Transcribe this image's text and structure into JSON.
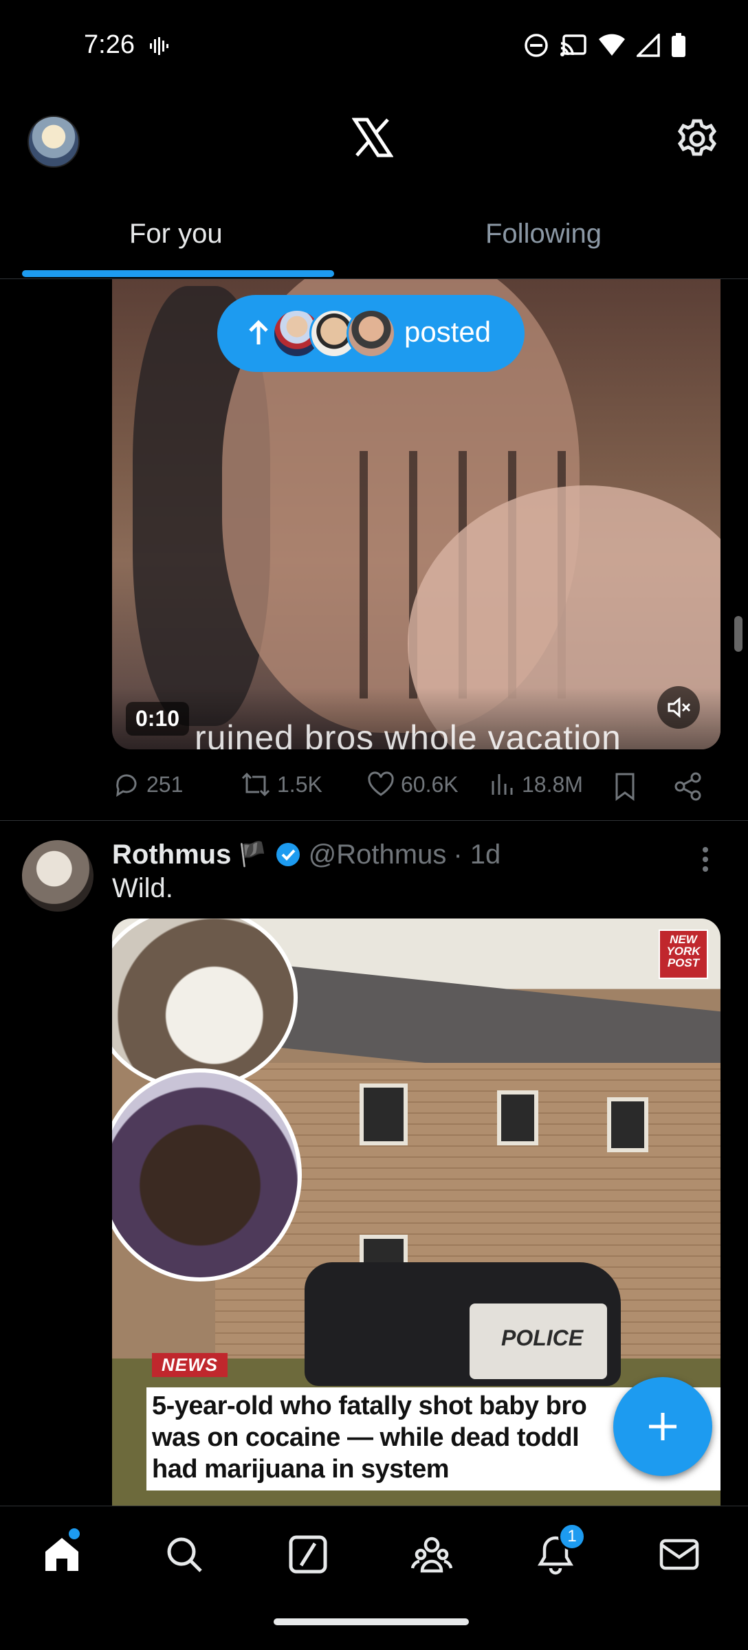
{
  "status_bar": {
    "time": "7:26"
  },
  "header": {
    "tabs": [
      {
        "label": "For you"
      },
      {
        "label": "Following"
      }
    ]
  },
  "video_post": {
    "posted_pill_label": "posted",
    "duration": "0:10",
    "caption": "ruined bros whole vacation",
    "stats": {
      "replies": "251",
      "reposts": "1.5K",
      "likes": "60.6K",
      "views": "18.8M"
    }
  },
  "tweet": {
    "name": "Rothmus",
    "flag_emoji": "🏴",
    "handle": "@Rothmus",
    "time": "· 1d",
    "text": "Wild.",
    "image": {
      "brand": "NEW YORK POST",
      "tag": "NEWS",
      "police_label": "POLICE",
      "headline": "5-year-old who fatally shot baby bro\nwas on cocaine — while dead toddl\nhad marijuana in system"
    }
  },
  "bottom_nav": {
    "notification_count": "1"
  },
  "colors": {
    "accent": "#1d9bf0",
    "muted": "#71767b",
    "text": "#e7e9ea",
    "background": "#000000"
  }
}
